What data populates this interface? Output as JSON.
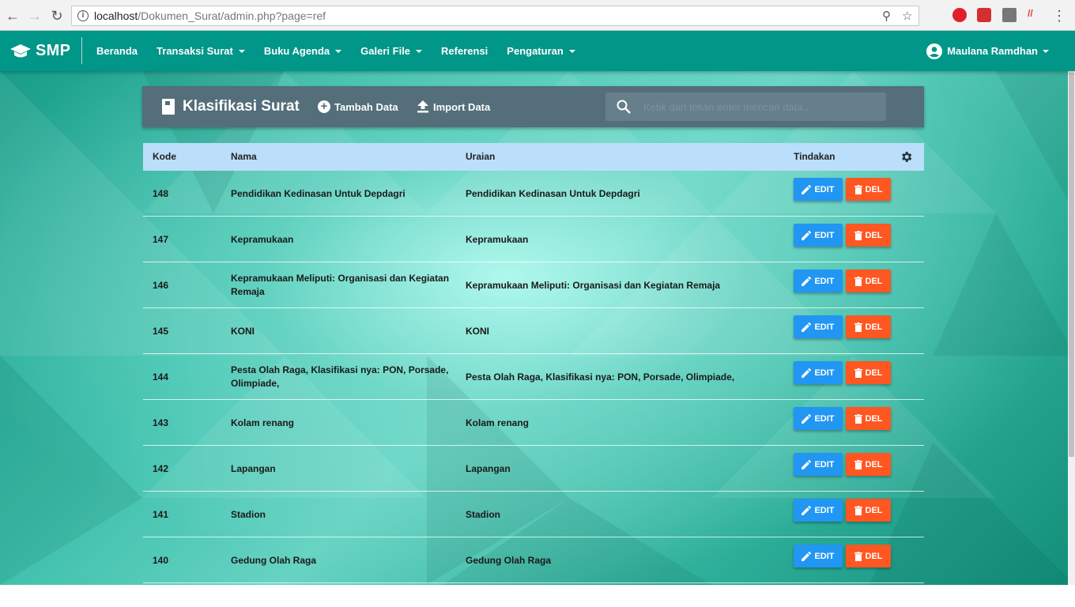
{
  "browser": {
    "url_host": "localhost",
    "url_path": "/Dokumen_Surat/admin.php?page=ref"
  },
  "app": {
    "brand": "SMP",
    "menu": [
      {
        "label": "Beranda",
        "dropdown": false
      },
      {
        "label": "Transaksi Surat",
        "dropdown": true
      },
      {
        "label": "Buku Agenda",
        "dropdown": true
      },
      {
        "label": "Galeri File",
        "dropdown": true
      },
      {
        "label": "Referensi",
        "dropdown": false
      },
      {
        "label": "Pengaturan",
        "dropdown": true
      }
    ],
    "user_name": "Maulana Ramdhan"
  },
  "header": {
    "title": "Klasifikasi Surat",
    "add_label": "Tambah Data",
    "import_label": "Import Data",
    "search_placeholder": "Ketik dan tekan enter mencari data..."
  },
  "table": {
    "columns": {
      "kode": "Kode",
      "nama": "Nama",
      "uraian": "Uraian",
      "tindakan": "Tindakan"
    },
    "edit_label": "EDIT",
    "del_label": "DEL",
    "rows": [
      {
        "kode": "148",
        "nama": "Pendidikan Kedinasan Untuk Depdagri",
        "uraian": "Pendidikan Kedinasan Untuk Depdagri"
      },
      {
        "kode": "147",
        "nama": "Kepramukaan",
        "uraian": "Kepramukaan"
      },
      {
        "kode": "146",
        "nama": "Kepramukaan Meliputi: Organisasi dan Kegiatan Remaja",
        "uraian": "Kepramukaan Meliputi: Organisasi dan Kegiatan Remaja"
      },
      {
        "kode": "145",
        "nama": "KONI",
        "uraian": "KONI"
      },
      {
        "kode": "144",
        "nama": "Pesta Olah Raga, Klasifikasi nya: PON, Porsade, Olimpiade,",
        "uraian": "Pesta Olah Raga, Klasifikasi nya: PON, Porsade, Olimpiade,"
      },
      {
        "kode": "143",
        "nama": "Kolam renang",
        "uraian": "Kolam renang"
      },
      {
        "kode": "142",
        "nama": "Lapangan",
        "uraian": "Lapangan"
      },
      {
        "kode": "141",
        "nama": "Stadion",
        "uraian": "Stadion"
      },
      {
        "kode": "140",
        "nama": "Gedung Olah Raga",
        "uraian": "Gedung Olah Raga"
      }
    ]
  },
  "colors": {
    "appbar": "#009688",
    "header_card": "#546e7a",
    "table_head": "#bbdefb",
    "edit": "#2196f3",
    "del": "#ff5722"
  }
}
